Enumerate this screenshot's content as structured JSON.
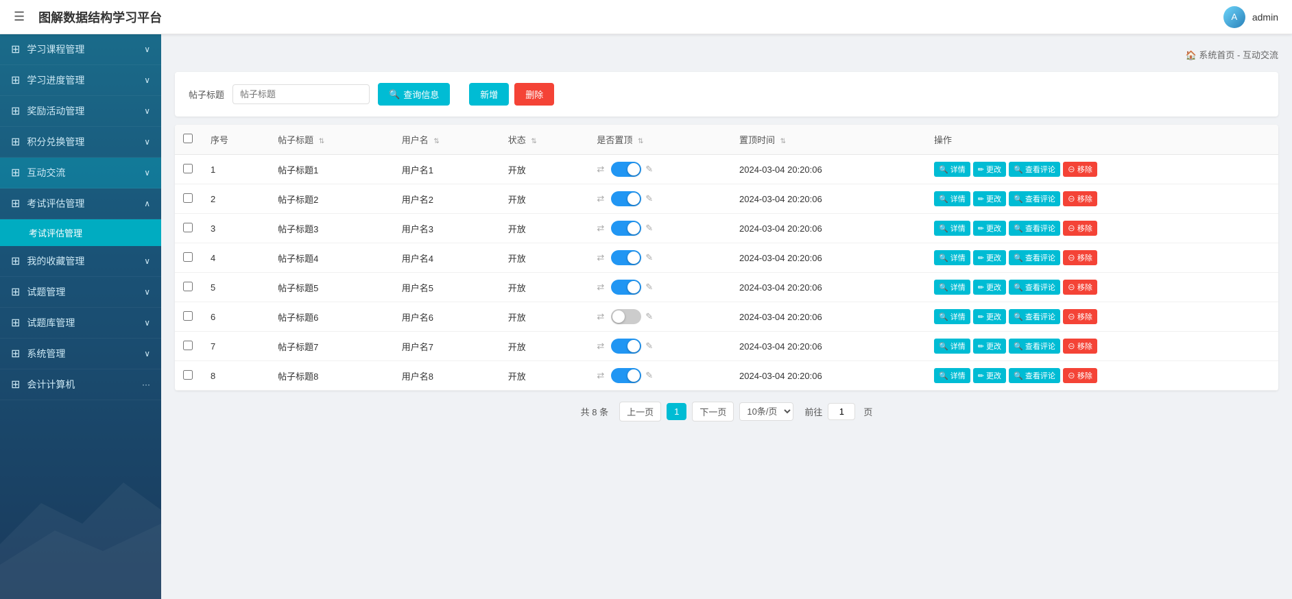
{
  "header": {
    "menu_icon": "☰",
    "title": "图解数据结构学习平台",
    "admin_label": "admin",
    "avatar_text": "A"
  },
  "sidebar": {
    "items": [
      {
        "id": "course",
        "icon": "⊞",
        "label": "学习课程管理",
        "expanded": false,
        "chevron": "∨"
      },
      {
        "id": "progress",
        "icon": "⊞",
        "label": "学习进度管理",
        "expanded": false,
        "chevron": "∨"
      },
      {
        "id": "reward",
        "icon": "⊞",
        "label": "奖励活动管理",
        "expanded": false,
        "chevron": "∨"
      },
      {
        "id": "points",
        "icon": "⊞",
        "label": "积分兑换管理",
        "expanded": false,
        "chevron": "∨"
      },
      {
        "id": "interact",
        "icon": "⊞",
        "label": "互动交流",
        "expanded": true,
        "chevron": "∨",
        "active": true
      },
      {
        "id": "exam",
        "icon": "⊞",
        "label": "考试评估管理",
        "expanded": true,
        "chevron": "∧"
      },
      {
        "id": "collection",
        "icon": "⊞",
        "label": "我的收藏管理",
        "expanded": false,
        "chevron": "∨"
      },
      {
        "id": "questions",
        "icon": "⊞",
        "label": "试题管理",
        "expanded": false,
        "chevron": "∨"
      },
      {
        "id": "questionbank",
        "icon": "⊞",
        "label": "试题库管理",
        "expanded": false,
        "chevron": "∨"
      },
      {
        "id": "system",
        "icon": "⊞",
        "label": "系统管理",
        "expanded": false,
        "chevron": "∨"
      },
      {
        "id": "other",
        "icon": "⊞",
        "label": "会计计算机",
        "expanded": false,
        "chevron": "···"
      }
    ],
    "exam_sub_items": [
      {
        "id": "exam-mgmt",
        "label": "考试评估管理",
        "active": true
      }
    ]
  },
  "breadcrumb": {
    "home_icon": "🏠",
    "home_label": "系统首页",
    "separator": " - ",
    "current": "互动交流"
  },
  "search": {
    "label": "帖子标题",
    "placeholder": "帖子标题",
    "button_icon": "🔍",
    "button_label": "查询信息"
  },
  "toolbar": {
    "add_label": "新增",
    "delete_label": "删除"
  },
  "table": {
    "columns": [
      {
        "id": "checkbox",
        "label": ""
      },
      {
        "id": "seq",
        "label": "序号"
      },
      {
        "id": "title",
        "label": "帖子标题",
        "sortable": true
      },
      {
        "id": "username",
        "label": "用户名",
        "sortable": true
      },
      {
        "id": "status",
        "label": "状态",
        "sortable": true
      },
      {
        "id": "pinned",
        "label": "是否置顶",
        "sortable": true
      },
      {
        "id": "pin_time",
        "label": "置顶时间",
        "sortable": true
      },
      {
        "id": "actions",
        "label": "操作"
      }
    ],
    "rows": [
      {
        "seq": 1,
        "title": "帖子标题1",
        "username": "用户名1",
        "status": "开放",
        "pinned": true,
        "pin_time": "2024-03-04 20:20:06"
      },
      {
        "seq": 2,
        "title": "帖子标题2",
        "username": "用户名2",
        "status": "开放",
        "pinned": true,
        "pin_time": "2024-03-04 20:20:06"
      },
      {
        "seq": 3,
        "title": "帖子标题3",
        "username": "用户名3",
        "status": "开放",
        "pinned": true,
        "pin_time": "2024-03-04 20:20:06"
      },
      {
        "seq": 4,
        "title": "帖子标题4",
        "username": "用户名4",
        "status": "开放",
        "pinned": true,
        "pin_time": "2024-03-04 20:20:06"
      },
      {
        "seq": 5,
        "title": "帖子标题5",
        "username": "用户名5",
        "status": "开放",
        "pinned": true,
        "pin_time": "2024-03-04 20:20:06"
      },
      {
        "seq": 6,
        "title": "帖子标题6",
        "username": "用户名6",
        "status": "开放",
        "pinned": false,
        "pin_time": "2024-03-04 20:20:06"
      },
      {
        "seq": 7,
        "title": "帖子标题7",
        "username": "用户名7",
        "status": "开放",
        "pinned": true,
        "pin_time": "2024-03-04 20:20:06"
      },
      {
        "seq": 8,
        "title": "帖子标题8",
        "username": "用户名8",
        "status": "开放",
        "pinned": true,
        "pin_time": "2024-03-04 20:20:06"
      }
    ],
    "action_labels": {
      "detail": "详情",
      "edit": "更改",
      "comment": "查看评论",
      "remove": "移除"
    }
  },
  "pagination": {
    "total_text": "共 8 条",
    "prev_label": "上一页",
    "next_label": "下一页",
    "current_page": 1,
    "page_size": "10条/页",
    "goto_label": "前往",
    "page_label": "页",
    "page_input_value": "1"
  }
}
